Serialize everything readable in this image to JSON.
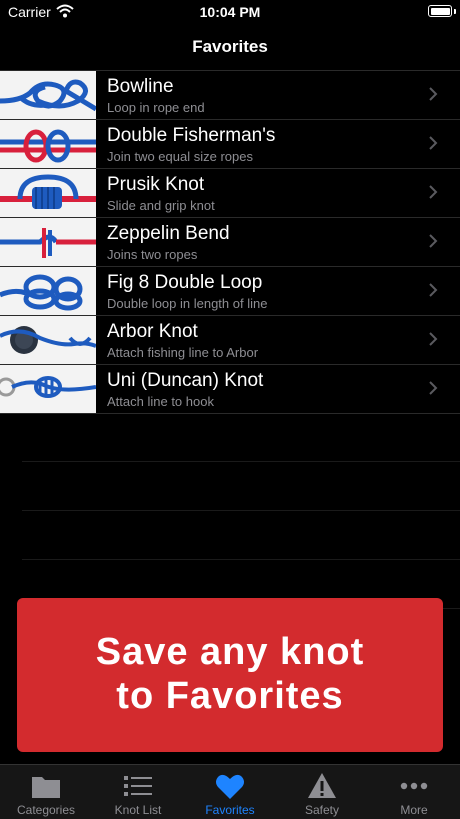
{
  "status_bar": {
    "carrier": "Carrier",
    "time": "10:04 PM"
  },
  "nav": {
    "title": "Favorites"
  },
  "knots": [
    {
      "name": "Bowline",
      "subtitle": "Loop in rope end"
    },
    {
      "name": "Double Fisherman's",
      "subtitle": "Join two equal size ropes"
    },
    {
      "name": "Prusik Knot",
      "subtitle": "Slide and grip knot"
    },
    {
      "name": "Zeppelin Bend",
      "subtitle": "Joins two ropes"
    },
    {
      "name": "Fig 8 Double Loop",
      "subtitle": "Double loop in length of line"
    },
    {
      "name": "Arbor Knot",
      "subtitle": "Attach fishing line to Arbor"
    },
    {
      "name": "Uni (Duncan) Knot",
      "subtitle": "Attach line to hook"
    }
  ],
  "promo": {
    "line1": "Save any knot",
    "line2": "to Favorites"
  },
  "tabs": [
    {
      "label": "Categories",
      "icon": "folder-icon"
    },
    {
      "label": "Knot List",
      "icon": "list-icon"
    },
    {
      "label": "Favorites",
      "icon": "heart-icon",
      "active": true
    },
    {
      "label": "Safety",
      "icon": "warning-icon"
    },
    {
      "label": "More",
      "icon": "more-icon"
    }
  ],
  "colors": {
    "accent": "#1e84ff",
    "promo_bg": "#d32b2e",
    "rope_blue": "#1e5bbf",
    "rope_red": "#d8203c"
  }
}
